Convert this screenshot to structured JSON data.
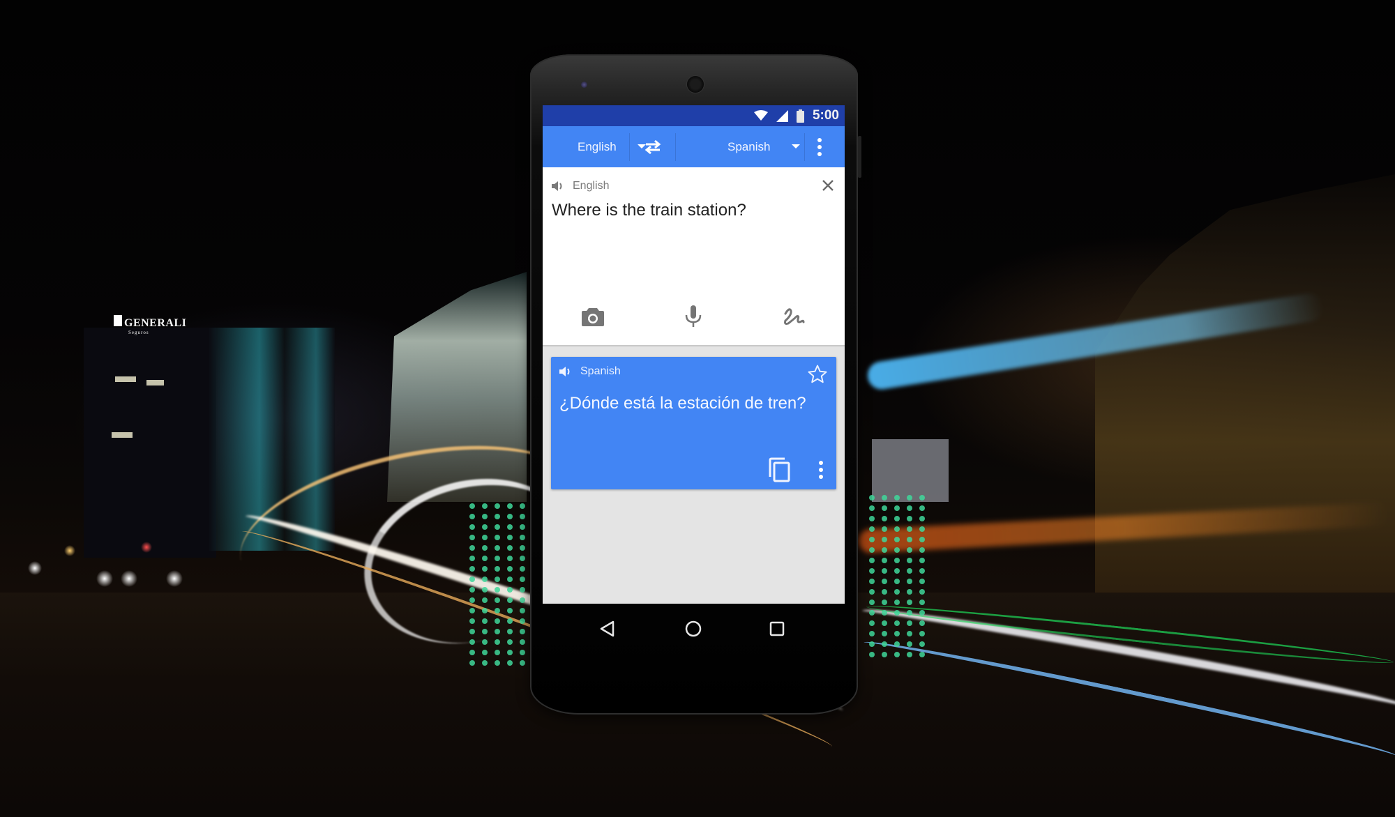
{
  "background": {
    "sign_text": "GENERALI",
    "sign_subtext": "Seguros",
    "accent_dots_color": "#3fd79a"
  },
  "phone": {
    "status_bar": {
      "icons": [
        "wifi-icon",
        "cell-signal-icon",
        "battery-icon"
      ],
      "time": "5:00",
      "color": "#1f3fa9"
    },
    "app_bar": {
      "color": "#4285f4",
      "source_language": "English",
      "target_language": "Spanish",
      "swap_icon": "swap-arrows-icon",
      "menu_icon": "more-vert-icon"
    },
    "source_panel": {
      "speaker_icon": "volume-icon",
      "language_label": "English",
      "text": "Where is the train station?",
      "clear_icon": "close-icon",
      "input_tools": [
        {
          "name": "camera-input",
          "icon": "camera-icon"
        },
        {
          "name": "voice-input",
          "icon": "microphone-icon"
        },
        {
          "name": "handwriting-input",
          "icon": "handwriting-icon"
        }
      ]
    },
    "translation_card": {
      "color": "#4285f4",
      "speaker_icon": "volume-icon",
      "language_label": "Spanish",
      "text": "¿Dónde está la estación de tren?",
      "favorite_icon": "star-outline-icon",
      "copy_icon": "copy-icon",
      "menu_icon": "more-vert-icon"
    },
    "nav_bar": {
      "buttons": [
        "back",
        "home",
        "recents"
      ]
    }
  }
}
